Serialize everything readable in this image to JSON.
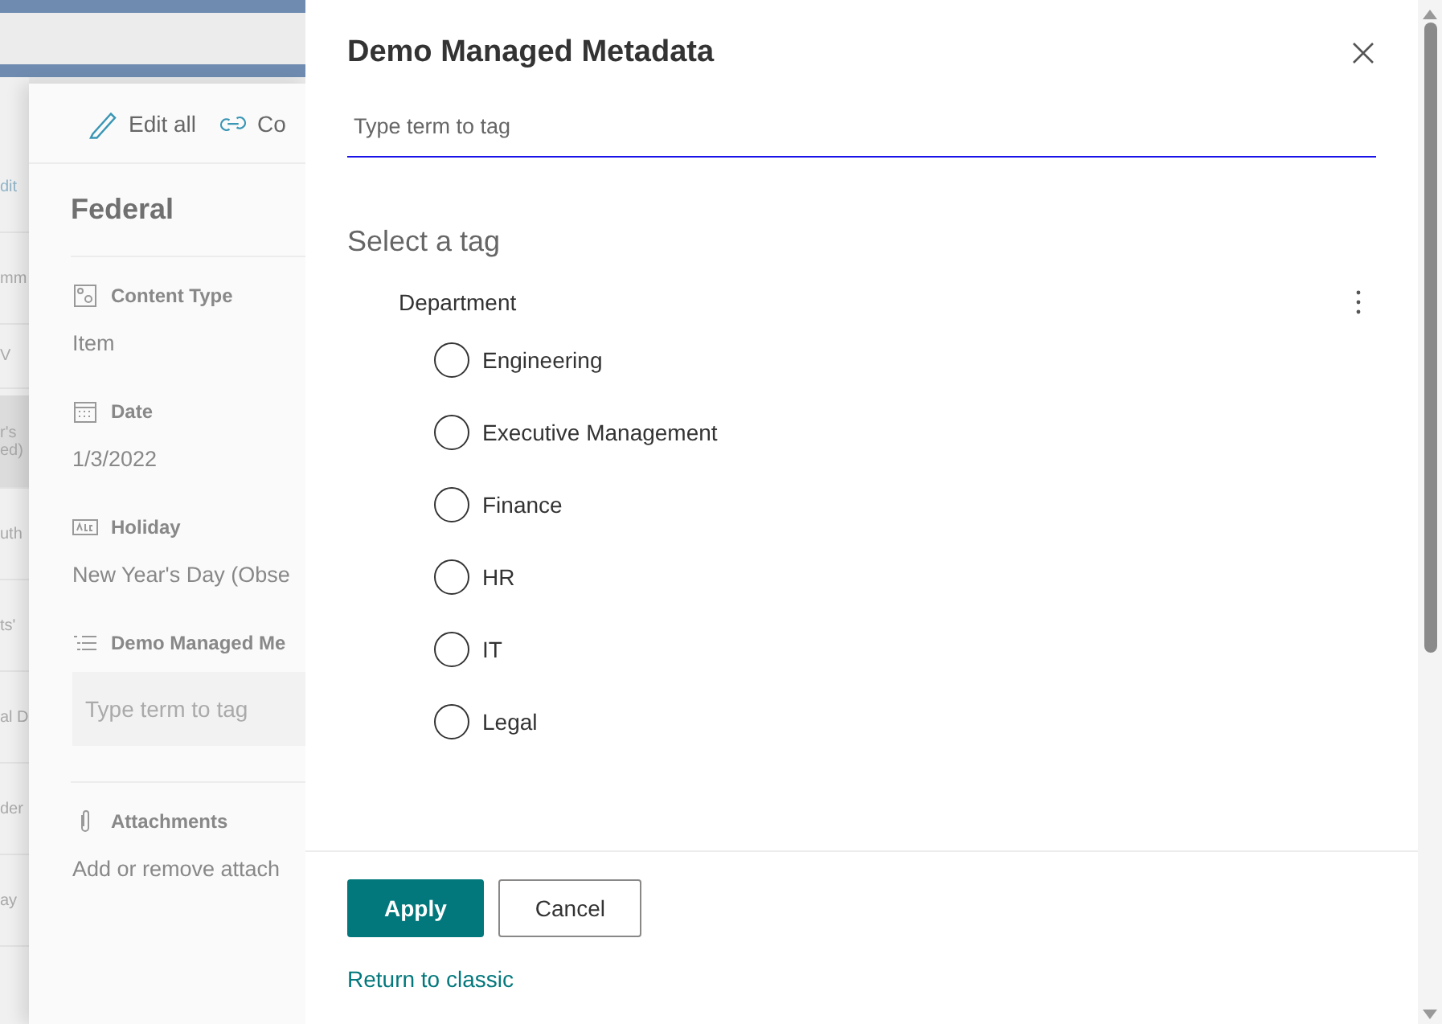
{
  "background_list": [
    {
      "kind": "link",
      "lines": [
        "dit"
      ]
    },
    {
      "kind": "text",
      "lines": [
        "mm"
      ]
    },
    {
      "kind": "sort",
      "lines": [
        "V"
      ]
    },
    {
      "kind": "selected",
      "lines": [
        "r's",
        "ed)"
      ]
    },
    {
      "kind": "text",
      "lines": [
        "uth"
      ]
    },
    {
      "kind": "text",
      "lines": [
        "ts'"
      ]
    },
    {
      "kind": "text",
      "lines": [
        "al D"
      ]
    },
    {
      "kind": "text",
      "lines": [
        "der"
      ]
    },
    {
      "kind": "text",
      "lines": [
        "ay"
      ]
    }
  ],
  "details_panel": {
    "toolbar": [
      {
        "label": "Edit all"
      },
      {
        "label": "Co"
      }
    ],
    "title": "Federal",
    "fields": [
      {
        "label": "Content Type",
        "kind": "text",
        "value": "Item"
      },
      {
        "label": "Date",
        "kind": "text",
        "value": "1/3/2022"
      },
      {
        "label": "Holiday",
        "kind": "text",
        "value": "New Year's Day (Obse"
      },
      {
        "label": "Demo Managed Me",
        "kind": "input",
        "placeholder": "Type term to tag"
      },
      {
        "label": "Attachments",
        "kind": "text",
        "value": "Add or remove attach"
      }
    ]
  },
  "dialog": {
    "title": "Demo Managed Metadata",
    "search": {
      "placeholder": "Type term to tag"
    },
    "heading": "Select a tag",
    "group": "Department",
    "options": [
      {
        "label": "Engineering",
        "selected": false
      },
      {
        "label": "Executive Management",
        "selected": false
      },
      {
        "label": "Finance",
        "selected": false
      },
      {
        "label": "HR",
        "selected": false
      },
      {
        "label": "IT",
        "selected": false
      },
      {
        "label": "Legal",
        "selected": false
      }
    ],
    "buttons": [
      {
        "label": "Apply",
        "kind": "primary"
      },
      {
        "label": "Cancel",
        "kind": "secondary"
      }
    ],
    "link": "Return to classic"
  }
}
